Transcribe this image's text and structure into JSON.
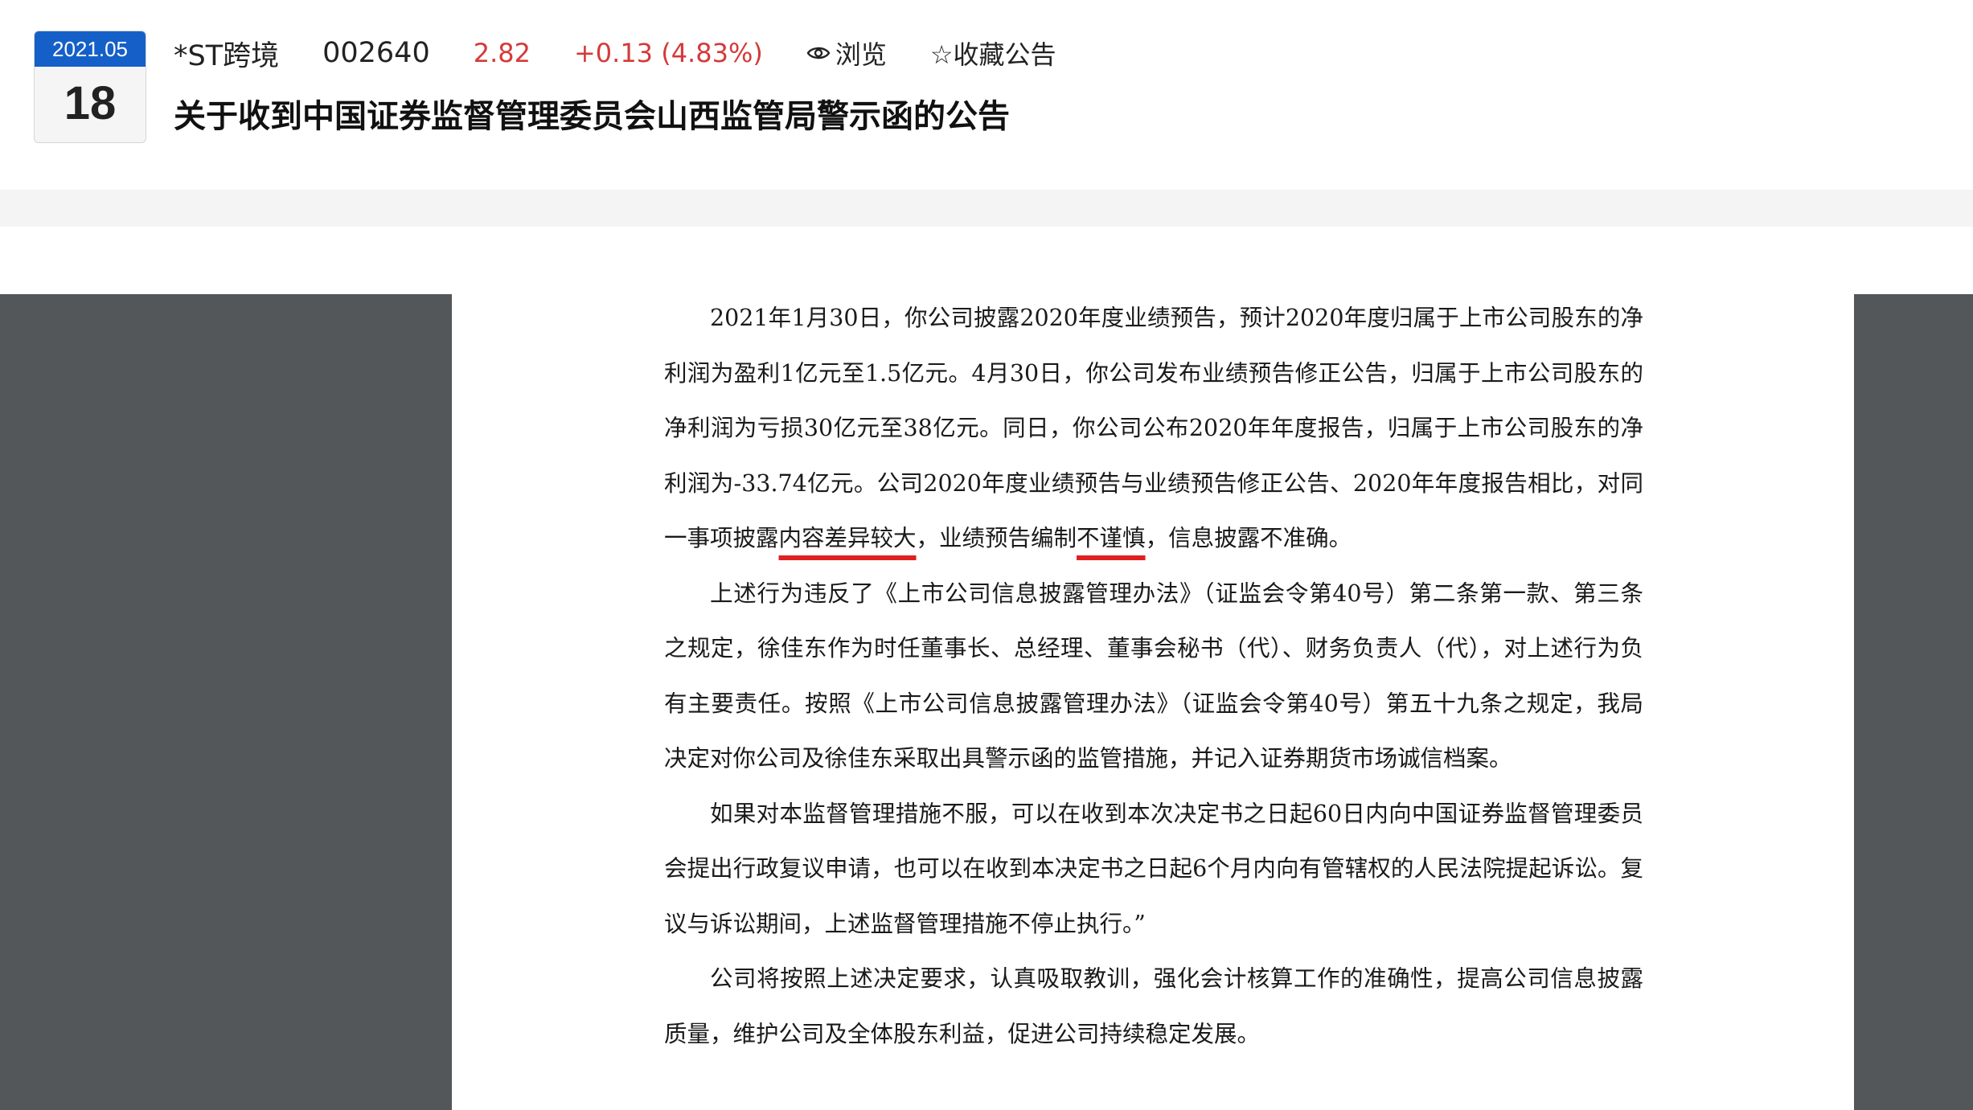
{
  "header": {
    "date_month": "2021.05",
    "date_day": "18",
    "stock_name": "*ST跨境",
    "stock_code": "002640",
    "price": "2.82",
    "change": "+0.13 (4.83%)",
    "browse_label": "浏览",
    "favorite_label": "☆收藏公告",
    "title": "关于收到中国证券监督管理委员会山西监管局警示函的公告"
  },
  "colors": {
    "accent_blue": "#1560c8",
    "price_red": "#d43a3a",
    "viewer_bg": "#53575a",
    "underline_red": "#e02020"
  },
  "icons": {
    "browse": "eye-icon"
  },
  "document": {
    "p1_a": "2021年1月30日，你公司披露2020年度业绩预告，预计2020年度归属于上市公司股东的净利润为盈利1亿元至1.5亿元。4月30日，你公司发布业绩预告修正公告，归属于上市公司股东的净利润为亏损30亿元至38亿元。同日，你公司公布2020年年度报告，归属于上市公司股东的净利润为-33.74亿元。公司2020年度业绩预告与业绩预告修正公告、2020年年度报告相比，对同一事项披露",
    "p1_hl1": "内容差异较大",
    "p1_b": "，业绩预告编制",
    "p1_hl2": "不谨慎",
    "p1_c": "，信息披露不准确。",
    "p2": "上述行为违反了《上市公司信息披露管理办法》（证监会令第40号）第二条第一款、第三条之规定，徐佳东作为时任董事长、总经理、董事会秘书（代）、财务负责人（代），对上述行为负有主要责任。按照《上市公司信息披露管理办法》（证监会令第40号）第五十九条之规定，我局决定对你公司及徐佳东采取出具警示函的监管措施，并记入证券期货市场诚信档案。",
    "p3": "如果对本监督管理措施不服，可以在收到本次决定书之日起60日内向中国证券监督管理委员会提出行政复议申请，也可以在收到本决定书之日起6个月内向有管辖权的人民法院提起诉讼。复议与诉讼期间，上述监督管理措施不停止执行。”",
    "p4": "公司将按照上述决定要求，认真吸取教训，强化会计核算工作的准确性，提高公司信息披露质量，维护公司及全体股东利益，促进公司持续稳定发展。"
  }
}
